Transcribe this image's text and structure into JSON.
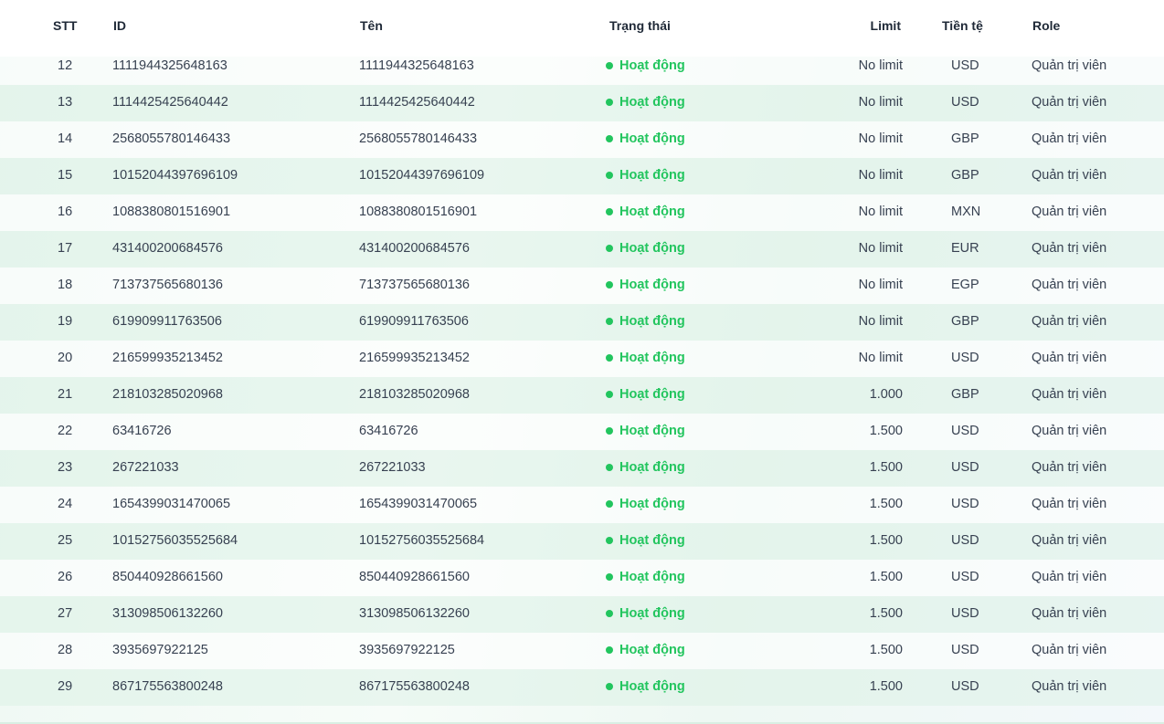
{
  "columns": {
    "stt": "STT",
    "id": "ID",
    "name": "Tên",
    "status": "Trạng thái",
    "limit": "Limit",
    "currency": "Tiền tệ",
    "role": "Role"
  },
  "colors": {
    "status_active": "#22c55e",
    "row_alt": "#d6f0e2",
    "text": "#374151"
  },
  "icons": {
    "status": "status-dot-icon"
  },
  "rows": [
    {
      "stt": "12",
      "id": "1111944325648163",
      "name": "1111944325648163",
      "status": "Hoạt động",
      "limit": "No limit",
      "currency": "USD",
      "role": "Quản trị viên"
    },
    {
      "stt": "13",
      "id": "1114425425640442",
      "name": "1114425425640442",
      "status": "Hoạt động",
      "limit": "No limit",
      "currency": "USD",
      "role": "Quản trị viên"
    },
    {
      "stt": "14",
      "id": "2568055780146433",
      "name": "2568055780146433",
      "status": "Hoạt động",
      "limit": "No limit",
      "currency": "GBP",
      "role": "Quản trị viên"
    },
    {
      "stt": "15",
      "id": "10152044397696109",
      "name": "10152044397696109",
      "status": "Hoạt động",
      "limit": "No limit",
      "currency": "GBP",
      "role": "Quản trị viên"
    },
    {
      "stt": "16",
      "id": "1088380801516901",
      "name": "1088380801516901",
      "status": "Hoạt động",
      "limit": "No limit",
      "currency": "MXN",
      "role": "Quản trị viên"
    },
    {
      "stt": "17",
      "id": "431400200684576",
      "name": "431400200684576",
      "status": "Hoạt động",
      "limit": "No limit",
      "currency": "EUR",
      "role": "Quản trị viên"
    },
    {
      "stt": "18",
      "id": "713737565680136",
      "name": "713737565680136",
      "status": "Hoạt động",
      "limit": "No limit",
      "currency": "EGP",
      "role": "Quản trị viên"
    },
    {
      "stt": "19",
      "id": "619909911763506",
      "name": "619909911763506",
      "status": "Hoạt động",
      "limit": "No limit",
      "currency": "GBP",
      "role": "Quản trị viên"
    },
    {
      "stt": "20",
      "id": "216599935213452",
      "name": "216599935213452",
      "status": "Hoạt động",
      "limit": "No limit",
      "currency": "USD",
      "role": "Quản trị viên"
    },
    {
      "stt": "21",
      "id": "218103285020968",
      "name": "218103285020968",
      "status": "Hoạt động",
      "limit": "1.000",
      "currency": "GBP",
      "role": "Quản trị viên"
    },
    {
      "stt": "22",
      "id": "63416726",
      "name": "63416726",
      "status": "Hoạt động",
      "limit": "1.500",
      "currency": "USD",
      "role": "Quản trị viên"
    },
    {
      "stt": "23",
      "id": "267221033",
      "name": "267221033",
      "status": "Hoạt động",
      "limit": "1.500",
      "currency": "USD",
      "role": "Quản trị viên"
    },
    {
      "stt": "24",
      "id": "1654399031470065",
      "name": "1654399031470065",
      "status": "Hoạt động",
      "limit": "1.500",
      "currency": "USD",
      "role": "Quản trị viên"
    },
    {
      "stt": "25",
      "id": "10152756035525684",
      "name": "10152756035525684",
      "status": "Hoạt động",
      "limit": "1.500",
      "currency": "USD",
      "role": "Quản trị viên"
    },
    {
      "stt": "26",
      "id": "850440928661560",
      "name": "850440928661560",
      "status": "Hoạt động",
      "limit": "1.500",
      "currency": "USD",
      "role": "Quản trị viên"
    },
    {
      "stt": "27",
      "id": "313098506132260",
      "name": "313098506132260",
      "status": "Hoạt động",
      "limit": "1.500",
      "currency": "USD",
      "role": "Quản trị viên"
    },
    {
      "stt": "28",
      "id": "3935697922125",
      "name": "3935697922125",
      "status": "Hoạt động",
      "limit": "1.500",
      "currency": "USD",
      "role": "Quản trị viên"
    },
    {
      "stt": "29",
      "id": "867175563800248",
      "name": "867175563800248",
      "status": "Hoạt động",
      "limit": "1.500",
      "currency": "USD",
      "role": "Quản trị viên"
    }
  ]
}
